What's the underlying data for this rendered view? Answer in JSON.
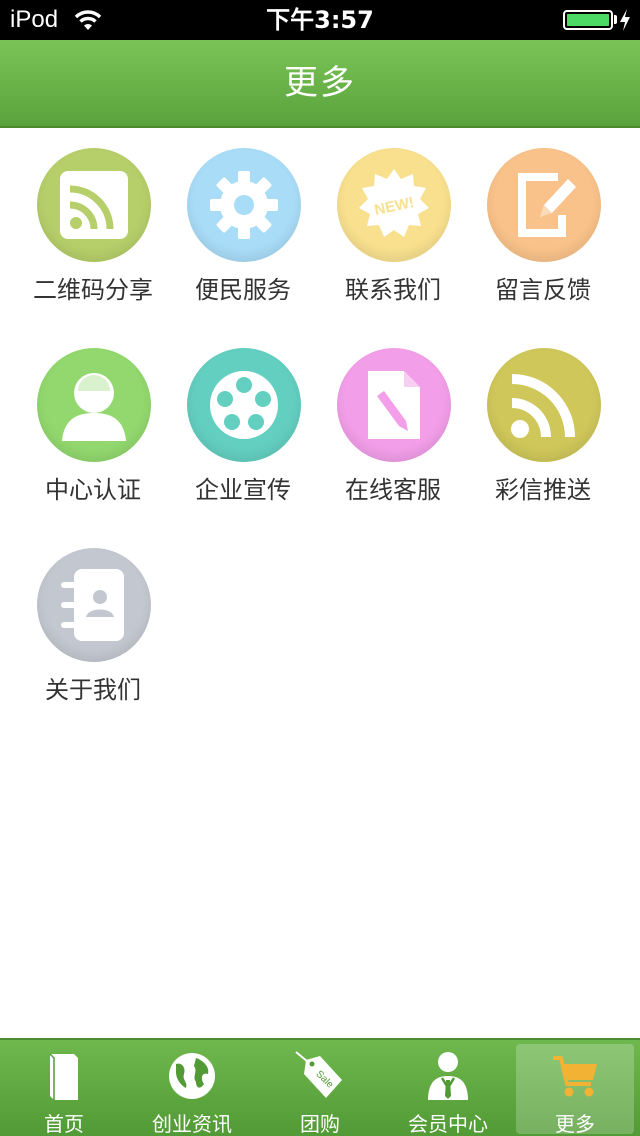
{
  "status_bar": {
    "carrier": "iPod",
    "time": "下午3:57"
  },
  "nav": {
    "title": "更多"
  },
  "items": [
    {
      "label": "二维码分享",
      "icon": "rss-square-icon",
      "color": "#b6cf6a"
    },
    {
      "label": "便民服务",
      "icon": "gear-icon",
      "color": "#a9dcf7"
    },
    {
      "label": "联系我们",
      "icon": "new-badge-icon",
      "color": "#f8e08e"
    },
    {
      "label": "留言反馈",
      "icon": "edit-note-icon",
      "color": "#f9c28a"
    },
    {
      "label": "中心认证",
      "icon": "user-icon",
      "color": "#92d86e"
    },
    {
      "label": "企业宣传",
      "icon": "film-reel-icon",
      "color": "#63cfc0"
    },
    {
      "label": "在线客服",
      "icon": "document-pencil-icon",
      "color": "#f29ee8"
    },
    {
      "label": "彩信推送",
      "icon": "rss-icon",
      "color": "#cfc75a"
    },
    {
      "label": "关于我们",
      "icon": "contacts-book-icon",
      "color": "#c3c8d0"
    }
  ],
  "new_badge_text": "NEW!",
  "tabs": [
    {
      "label": "首页",
      "icon": "book-icon"
    },
    {
      "label": "创业资讯",
      "icon": "globe-icon"
    },
    {
      "label": "团购",
      "icon": "sale-tag-icon"
    },
    {
      "label": "会员中心",
      "icon": "member-icon"
    },
    {
      "label": "更多",
      "icon": "cart-icon",
      "active": true
    }
  ],
  "colors": {
    "header_green": "#62ad44",
    "active_tab_tint": "rgba(255,255,255,0.22)"
  },
  "sale_tag_text": "Sale"
}
